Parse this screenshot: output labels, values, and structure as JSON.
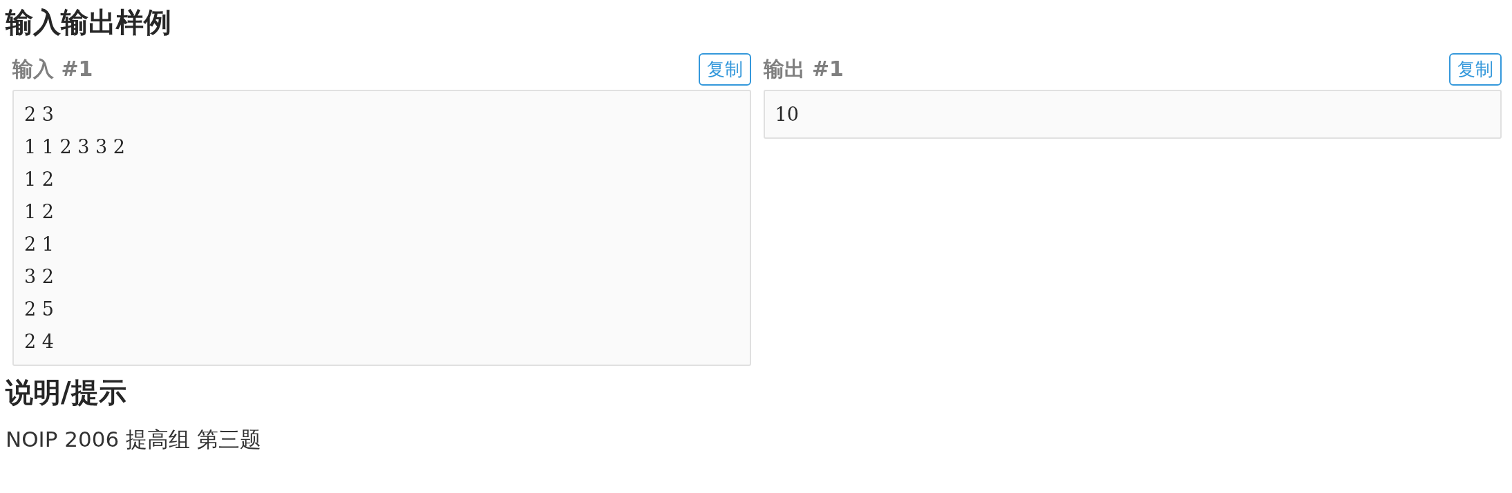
{
  "sections": [
    {
      "title": "输入输出样例"
    }
  ],
  "samples": [
    {
      "label": "输入 #1",
      "copy_button": "复制",
      "lines": [
        "2 3",
        "1 1 2 3 3 2",
        "1 2",
        "1 2",
        "2 1",
        "3 2",
        "2 5",
        "2 4"
      ]
    },
    {
      "label": "输出 #1",
      "copy_button": "复制",
      "lines": [
        "10"
      ]
    }
  ],
  "hint": {
    "title": "说明/提示",
    "text": "NOIP 2006 提高组 第三题"
  }
}
